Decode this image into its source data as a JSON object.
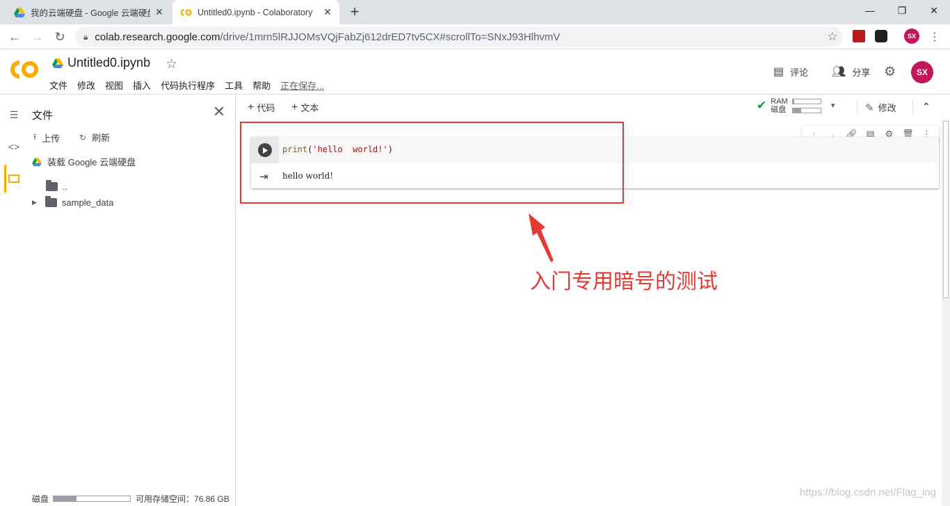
{
  "browser": {
    "tabs": [
      {
        "title": "我的云端硬盘 - Google 云端硬盘",
        "active": false
      },
      {
        "title": "Untitled0.ipynb - Colaboratory",
        "active": true
      }
    ],
    "url_host": "colab.research.google.com",
    "url_path": "/drive/1mrn5lRJJOMsVQjFabZj612drED7tv5CX#scrollTo=SNxJ93HlhvmV",
    "profile_initials": "SX"
  },
  "header": {
    "notebook_title": "Untitled0.ipynb",
    "menu": [
      "文件",
      "修改",
      "视图",
      "插入",
      "代码执行程序",
      "工具",
      "帮助"
    ],
    "save_status": "正在保存...",
    "comment_label": "评论",
    "share_label": "分享",
    "avatar_initials": "SX"
  },
  "sidebar": {
    "title": "文件",
    "upload_label": "上传",
    "refresh_label": "刷新",
    "mount_label": "装载 Google 云端硬盘",
    "parent_dir": "..",
    "folders": [
      "sample_data"
    ],
    "disk_label": "磁盘",
    "disk_used_fraction": 0.3,
    "disk_available": "可用存储空间：76.86 GB"
  },
  "notebook_toolbar": {
    "add_code": "代码",
    "add_text": "文本",
    "ram_label": "RAM",
    "disk_label": "磁盘",
    "ram_fraction": 0.05,
    "disk_fraction": 0.3,
    "edit_label": "修改"
  },
  "cell": {
    "code_fn": "print",
    "code_open": "(",
    "code_string": "'hello  world!'",
    "code_close": ")",
    "output": "hello world!"
  },
  "annotation": {
    "text": "入门专用暗号的测试"
  },
  "watermark": "https://blog.csdn.net/Flag_ing",
  "colors": {
    "annotation_red": "#e53935",
    "avatar": "#c2185b",
    "check_green": "#1e8e3e",
    "colab_orange": "#f9ab00"
  }
}
